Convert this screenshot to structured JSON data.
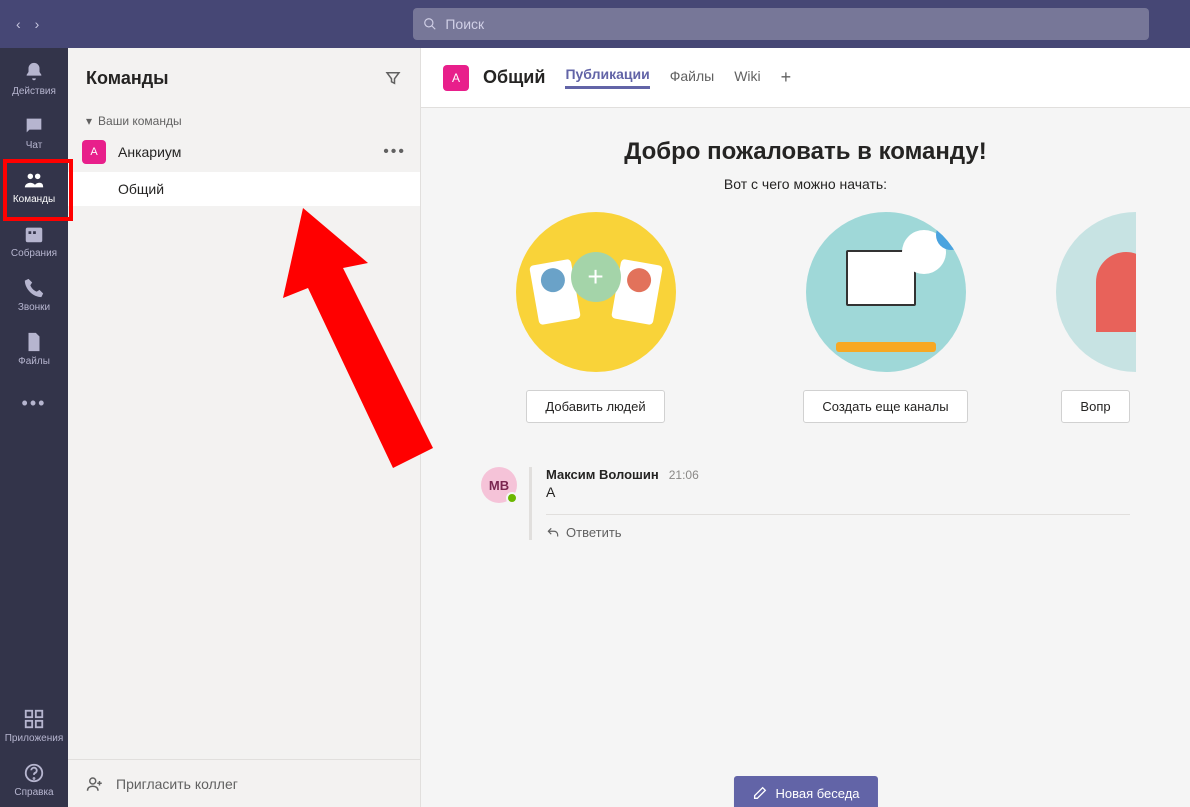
{
  "search": {
    "placeholder": "Поиск"
  },
  "rail": {
    "activity": "Действия",
    "chat": "Чат",
    "teams": "Команды",
    "meetings": "Собрания",
    "calls": "Звонки",
    "files": "Файлы",
    "apps": "Приложения",
    "help": "Справка"
  },
  "panel": {
    "title": "Команды",
    "your_teams": "Ваши команды",
    "team_name": "Анкариум",
    "team_initial": "А",
    "channel": "Общий",
    "invite": "Пригласить коллег"
  },
  "header": {
    "avatar_initial": "А",
    "channel_title": "Общий",
    "tab_posts": "Публикации",
    "tab_files": "Файлы",
    "tab_wiki": "Wiki"
  },
  "welcome": {
    "title": "Добро пожаловать в команду!",
    "subtitle": "Вот с чего можно начать:",
    "btn_add_people": "Добавить людей",
    "btn_more_channels": "Создать еще каналы",
    "btn_faq": "Вопр"
  },
  "message": {
    "avatar": "МВ",
    "author": "Максим Волошин",
    "time": "21:06",
    "text": "А",
    "reply": "Ответить"
  },
  "compose": {
    "new_conversation": "Новая беседа"
  }
}
